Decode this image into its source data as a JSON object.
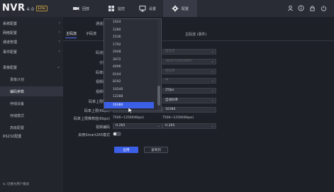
{
  "topbar": {
    "logo": "NVR",
    "version": "4.0",
    "badge": "Lite",
    "nav": [
      {
        "label": "回放",
        "icon": "camera-icon"
      },
      {
        "label": "监控",
        "icon": "grid-icon"
      },
      {
        "label": "设置",
        "icon": "monitor-icon"
      },
      {
        "label": "配置",
        "icon": "gear-icon"
      }
    ]
  },
  "sidebar": {
    "items": [
      {
        "label": "系统配置"
      },
      {
        "label": "网络配置"
      },
      {
        "label": "通道管理"
      },
      {
        "label": "事件配置"
      },
      {
        "label": "录像配置"
      }
    ],
    "subitems": [
      {
        "label": "录像计划"
      },
      {
        "label": "编码参数"
      },
      {
        "label": "存储设备"
      },
      {
        "label": "存储模式"
      },
      {
        "label": "高级配置"
      },
      {
        "label": "RS232配置"
      }
    ],
    "footer": "切换为用户模式"
  },
  "content": {
    "channel_label": "通道选择",
    "tabs": [
      "主码流",
      "子码流"
    ],
    "main_stream_header": "主码流 (事件)",
    "rows": [
      {
        "label": "码流类型",
        "right": "复合流"
      },
      {
        "label": "分辨率",
        "right": "3840*2160(8MP)"
      },
      {
        "label": "码率类型",
        "right": "定码率"
      },
      {
        "label": "视频质量",
        "right": "中"
      },
      {
        "label": "视频帧率",
        "right": "25fps"
      },
      {
        "label": "码率上限模式",
        "left": "",
        "right": "自动码率"
      },
      {
        "label": "码率上限(Kbps)",
        "left": "16384",
        "right": "16384"
      },
      {
        "label": "码率上限推荐值(Kbps)",
        "left": "7500~12500(Kbps)",
        "right": "7500~12500(Kbps)"
      },
      {
        "label": "视频编码",
        "left": "H.265",
        "right": "H.265"
      },
      {
        "label": "启用Smart265模式",
        "left": ""
      }
    ],
    "dropdown_options": [
      "1024",
      "1280",
      "1536",
      "1792",
      "2048",
      "3072",
      "4096",
      "6144",
      "8192",
      "10240",
      "12288",
      "16384"
    ],
    "dropdown_selected": "16384",
    "apply_button": "应用",
    "copy_button": "复制到"
  },
  "colors": {
    "accent": "#3c5fe8",
    "background": "#1e2028",
    "topbar": "#2a2c35",
    "sidebar": "#23252d"
  }
}
